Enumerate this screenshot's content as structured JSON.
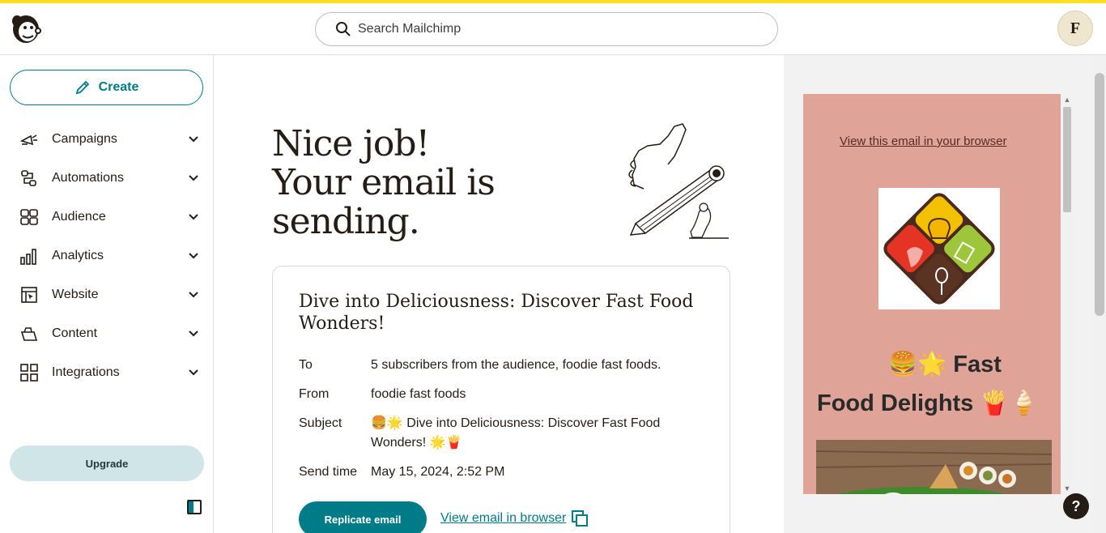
{
  "header": {
    "search_placeholder": "Search Mailchimp",
    "avatar_initial": "F",
    "accent_color": "#ffe01b"
  },
  "sidebar": {
    "create_label": "Create",
    "items": [
      {
        "label": "Campaigns",
        "icon": "megaphone-icon"
      },
      {
        "label": "Automations",
        "icon": "automation-icon"
      },
      {
        "label": "Audience",
        "icon": "audience-icon"
      },
      {
        "label": "Analytics",
        "icon": "bar-chart-icon"
      },
      {
        "label": "Website",
        "icon": "website-icon"
      },
      {
        "label": "Content",
        "icon": "content-icon"
      },
      {
        "label": "Integrations",
        "icon": "grid-icon"
      }
    ],
    "upgrade_label": "Upgrade"
  },
  "main": {
    "headline_line1": "Nice job!",
    "headline_line2": "Your email is",
    "headline_line3": "sending.",
    "card": {
      "title": "Dive into Deliciousness: Discover Fast Food Wonders!",
      "rows": [
        {
          "label": "To",
          "value": "5 subscribers from the audience, foodie fast foods."
        },
        {
          "label": "From",
          "value": "foodie fast foods"
        },
        {
          "label": "Subject",
          "value": "🍔🌟 Dive into Deliciousness: Discover Fast Food Wonders! 🌟🍟"
        },
        {
          "label": "Send time",
          "value": "May 15, 2024, 2:52 PM"
        }
      ],
      "replicate_label": "Replicate email",
      "view_browser_label": "View email in browser"
    }
  },
  "preview": {
    "view_link": "View this email in your browser",
    "heading_line1": "🍔🌟 Fast",
    "heading_line2": "Food Delights 🍟🍦",
    "background_color": "#dfa397"
  },
  "help_label": "?",
  "colors": {
    "brand_teal": "#007c89",
    "upgrade_bg": "#cfe5e8"
  }
}
